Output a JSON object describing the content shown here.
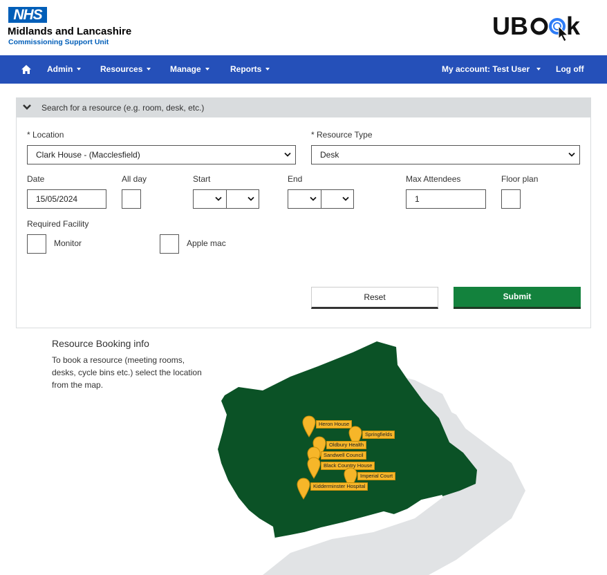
{
  "header": {
    "nhs_logo_text": "NHS",
    "org_name": "Midlands and Lancashire",
    "org_subtitle": "Commissioning Support Unit",
    "app_logo": "UBook"
  },
  "nav": {
    "home_icon": "home-icon",
    "items": [
      {
        "label": "Admin"
      },
      {
        "label": "Resources"
      },
      {
        "label": "Manage"
      },
      {
        "label": "Reports"
      }
    ],
    "account_label": "My account: Test User",
    "logout_label": "Log off",
    "bg_color": "#2550b9"
  },
  "search": {
    "title": "Search for a resource (e.g. room, desk, etc.)",
    "location_label": "* Location",
    "location_value": "Clark House - (Macclesfield)",
    "resource_type_label": "* Resource Type",
    "resource_type_value": "Desk",
    "date_label": "Date",
    "date_value": "15/05/2024",
    "all_day_label": "All day",
    "start_label": "Start",
    "end_label": "End",
    "max_attendees_label": "Max Attendees",
    "max_attendees_value": "1",
    "floor_plan_label": "Floor plan",
    "required_facility_label": "Required Facility",
    "facilities": [
      {
        "label": "Monitor"
      },
      {
        "label": "Apple mac"
      }
    ],
    "reset_label": "Reset",
    "submit_label": "Submit",
    "submit_color": "#13823d"
  },
  "info": {
    "title": "Resource Booking info",
    "text": "To book a resource (meeting rooms, desks, cycle bins etc.) select the location from the map."
  },
  "map": {
    "region_color": "#0b5226",
    "pin_color": "#f6b629",
    "locations": [
      {
        "name": "Heron House"
      },
      {
        "name": "Springfields"
      },
      {
        "name": "Oldbury Health"
      },
      {
        "name": "Sandwell Council"
      },
      {
        "name": "Black Country House"
      },
      {
        "name": "Imperial Court"
      },
      {
        "name": "Kidderminster Hospital"
      }
    ]
  }
}
